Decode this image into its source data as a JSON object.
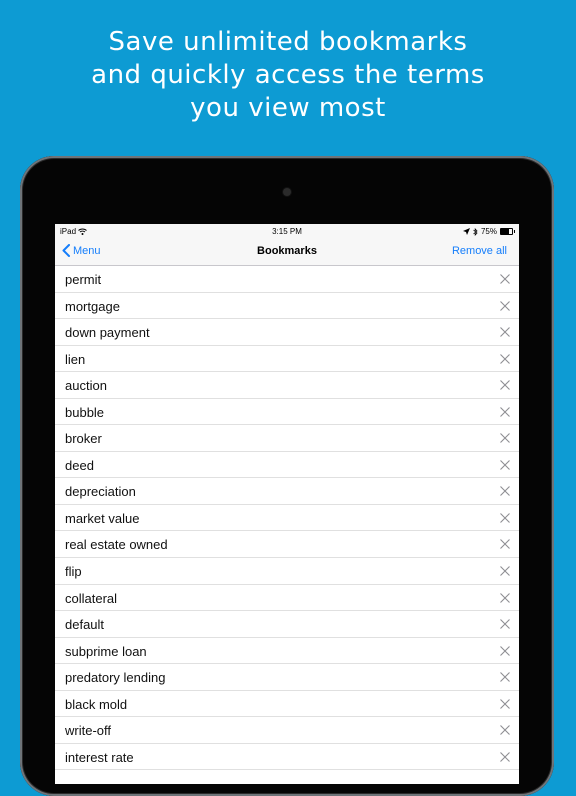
{
  "headline": {
    "line1": "Save unlimited bookmarks",
    "line2": "and quickly access the terms",
    "line3": "you view most"
  },
  "status_bar": {
    "carrier": "iPad",
    "time": "3:15 PM",
    "battery_text": "75%",
    "battery_level": 0.75
  },
  "nav": {
    "back_label": "Menu",
    "title": "Bookmarks",
    "remove_all_label": "Remove all"
  },
  "bookmarks": [
    "permit",
    "mortgage",
    "down payment",
    "lien",
    "auction",
    "bubble",
    "broker",
    "deed",
    "depreciation",
    "market value",
    "real estate owned",
    "flip",
    "collateral",
    "default",
    "subprime loan",
    "predatory lending",
    "black mold",
    "write-off",
    "interest rate"
  ],
  "colors": {
    "background": "#0d9bd3",
    "ios_blue": "#157efb"
  },
  "icons": {
    "back": "chevron-left-icon",
    "delete": "close-icon",
    "wifi": "wifi-icon",
    "location": "location-arrow-icon",
    "bluetooth": "bluetooth-icon",
    "battery": "battery-icon"
  }
}
